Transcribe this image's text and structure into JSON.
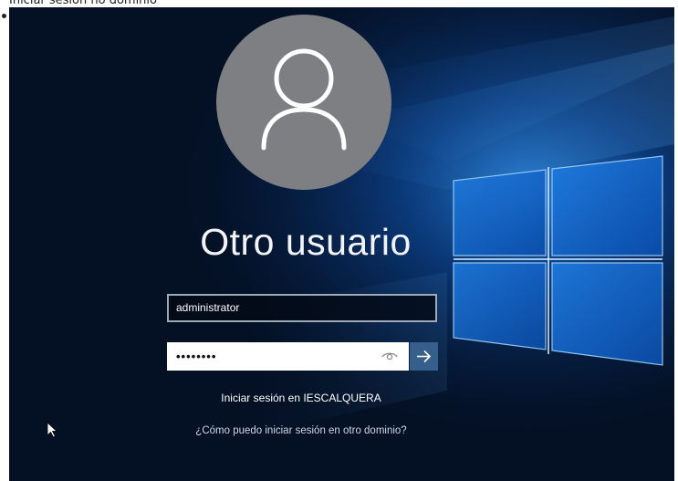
{
  "caption": "Iniciar sesión no dominio",
  "login": {
    "user_display_name": "Otro usuario",
    "username_value": "administrator",
    "password_masked": "••••••••",
    "sign_in_to_domain": "Iniciar sesión en IESCALQUERA",
    "other_domain_link": "¿Cómo puedo iniciar sesión en otro dominio?"
  },
  "icons": {
    "avatar": "user-silhouette-icon",
    "reveal_password": "eye-icon",
    "submit": "arrow-right-icon",
    "pointer": "mouse-pointer-icon"
  },
  "colors": {
    "background": "#041024",
    "avatar": "#7d7f82",
    "submit_button": "#375f8c",
    "text": "#f2f4f7"
  }
}
